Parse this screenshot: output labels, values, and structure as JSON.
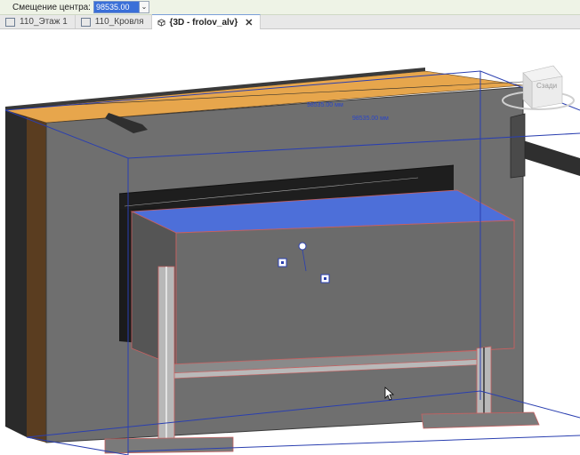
{
  "options_bar": {
    "offset_label": "Смещение центра:",
    "offset_value": "98535.00 мм",
    "dropdown_glyph": "⌄"
  },
  "tabs": [
    {
      "label": "110_Этаж 1",
      "icon": "floor-plan-icon"
    },
    {
      "label": "110_Кровля",
      "icon": "floor-plan-icon"
    },
    {
      "label": "{3D - frolov_alv}",
      "icon": "3d-view-icon",
      "active": true,
      "close": "✕"
    }
  ],
  "viewport": {
    "viewcube_label": "Сзади",
    "dimension_labels": [
      "98535.00 мм",
      "98535.00 мм"
    ]
  },
  "colors": {
    "section_box": "#2a3fb0",
    "wall": "#6f6f6f",
    "roof_insulation": "#e7a64c",
    "hvac_duct": "#6f6f6f",
    "selection": "#4d6fd9"
  }
}
